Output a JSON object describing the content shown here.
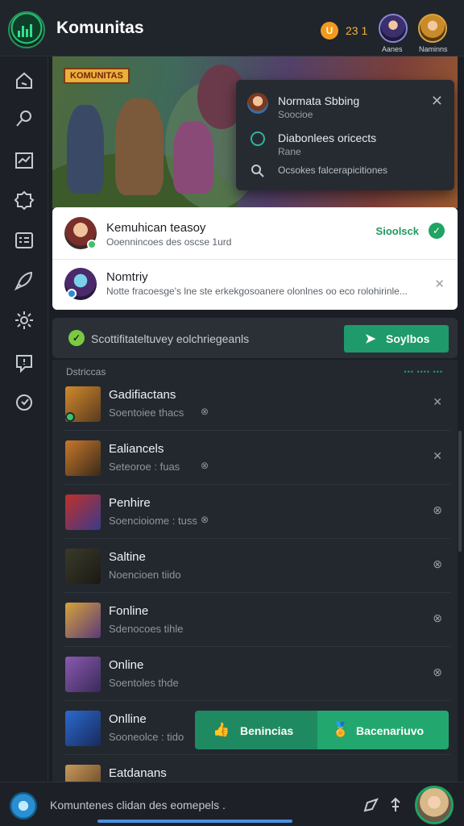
{
  "header": {
    "title": "Komunitas",
    "coin_icon_label": "U",
    "coin_count": "23 1",
    "avatars": [
      {
        "label": "Aanes",
        "icon": "avatar-mage"
      },
      {
        "label": "Naminns",
        "icon": "avatar-heroine"
      }
    ]
  },
  "sidebar": {
    "icons": [
      "home-icon",
      "search-icon",
      "chart-icon",
      "settings-icon",
      "list-icon",
      "rocket-icon",
      "gear-icon",
      "chat-icon",
      "help-icon"
    ]
  },
  "banner": {
    "tag": "KOMUNITAS"
  },
  "notification_popup": {
    "items": [
      {
        "title": "Normata Sbbing",
        "sub": "Soocioe",
        "icon": "avatar-icon"
      },
      {
        "title": "Diabonlees oricects",
        "sub": "Rane",
        "icon": "clock-icon"
      },
      {
        "title": "Ocsokes falcerapicitiones",
        "sub": "",
        "icon": "search-icon"
      }
    ],
    "close_label": "✕"
  },
  "featured": {
    "rows": [
      {
        "title": "Kemuhican teasoy",
        "sub": "Ooennincoes des oscse 1urd",
        "action": "Sioolsck",
        "check": "✓"
      },
      {
        "title": "Nomtriy",
        "sub": "Notte fracoesge's lne ste erkekgosoanere olonlnes oo eco rolohirinle...",
        "close": "✕"
      }
    ]
  },
  "status": {
    "text": "Scottifitateltuvey eolchriegeanls",
    "check": "✓",
    "button_label": "Soylbos"
  },
  "list": {
    "section_label": "Dstriccas",
    "section_dots": "••• •••• •••",
    "rows": [
      {
        "name": "Gadifiactans",
        "sub": "Soentoiee thacs",
        "mini": "⊗",
        "end": "✕"
      },
      {
        "name": "Ealiancels",
        "sub": "Seteoroe : fuas",
        "mini": "⊗",
        "end": "✕"
      },
      {
        "name": "Penhire",
        "sub": "Soencioiome : tuss",
        "mini": "⊗",
        "end": "⊗"
      },
      {
        "name": "Saltine",
        "sub": "Noencioen tiido",
        "mini": "",
        "end": "⊗"
      },
      {
        "name": "Fonline",
        "sub": "Sdenocoes tihle",
        "mini": "",
        "end": "⊗"
      },
      {
        "name": "Online",
        "sub": "Soentoles thde",
        "mini": "",
        "end": "⊗"
      },
      {
        "name": "Onlline",
        "sub": "Sooneolce : tido",
        "mini": "",
        "end": ""
      },
      {
        "name": "Eatdanans",
        "sub": "",
        "mini": "",
        "end": ""
      }
    ],
    "row_actions": [
      {
        "label": "Benincias",
        "icon": "👍"
      },
      {
        "label": "Bacenariuvo",
        "icon": "🏅"
      }
    ]
  },
  "bottom": {
    "text": "Komuntenes clidan des eomepels ."
  },
  "colors": {
    "accent_green": "#1f9a6a",
    "background": "#1b1f25",
    "coin": "#f39a1e"
  }
}
